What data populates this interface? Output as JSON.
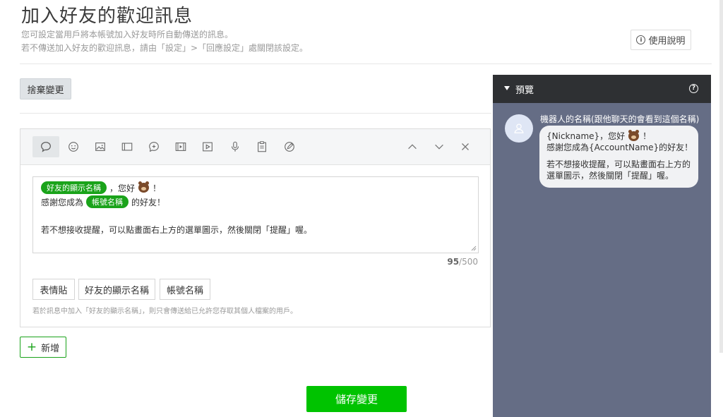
{
  "header": {
    "title": "加入好友的歡迎訊息",
    "desc_line1": "您可設定當用戶將本帳號加入好友時所自動傳送的訊息。",
    "desc_line2": "若不傳送加入好友的歡迎訊息，請由「設定」>「回應設定」處關閉該設定。",
    "help_label": "使用說明"
  },
  "discard_label": "捨棄變更",
  "toolbar": {
    "icons": [
      "text-bubble-icon",
      "sticker-icon",
      "image-icon",
      "card-icon",
      "coupon-icon",
      "video-icon",
      "play-icon",
      "microphone-icon",
      "survey-icon",
      "rich-message-icon"
    ],
    "nav": [
      "move-up-icon",
      "move-down-icon",
      "close-icon"
    ]
  },
  "message": {
    "tag_nickname": "好友的顯示名稱",
    "line1_after": "，您好",
    "line1_end": "！",
    "line2_before": "感謝您成為",
    "tag_account": "帳號名稱",
    "line2_after": "的好友！",
    "line3": "若不想接收提醒，可以點畫面右上方的選單圖示，然後關閉「提醒」喔。",
    "count": "95",
    "max": "/500"
  },
  "chips": {
    "emoji": "表情貼",
    "nickname": "好友的顯示名稱",
    "account": "帳號名稱"
  },
  "note": "若於訊息中加入「好友的顯示名稱」，則只會傳送給已允許您存取其個人檔案的用戶。",
  "add_label": "新增",
  "save_label": "儲存變更",
  "preview": {
    "title": "預覽",
    "bot_name": "機器人的名稱(跟他聊天的會看到這個名稱)",
    "line1_a": "{Nickname}，您好",
    "line1_b": "！",
    "line2": "感謝您成為{AccountName}的好友！",
    "line3": "若不想接收提醒，可以點畫面右上方的",
    "line4": "選單圖示，然後關閉「提醒」喔。"
  },
  "colors": {
    "accent": "#00c300",
    "tag": "#1aa31a",
    "preview_bg": "#656d85",
    "preview_header": "#2e3033"
  }
}
